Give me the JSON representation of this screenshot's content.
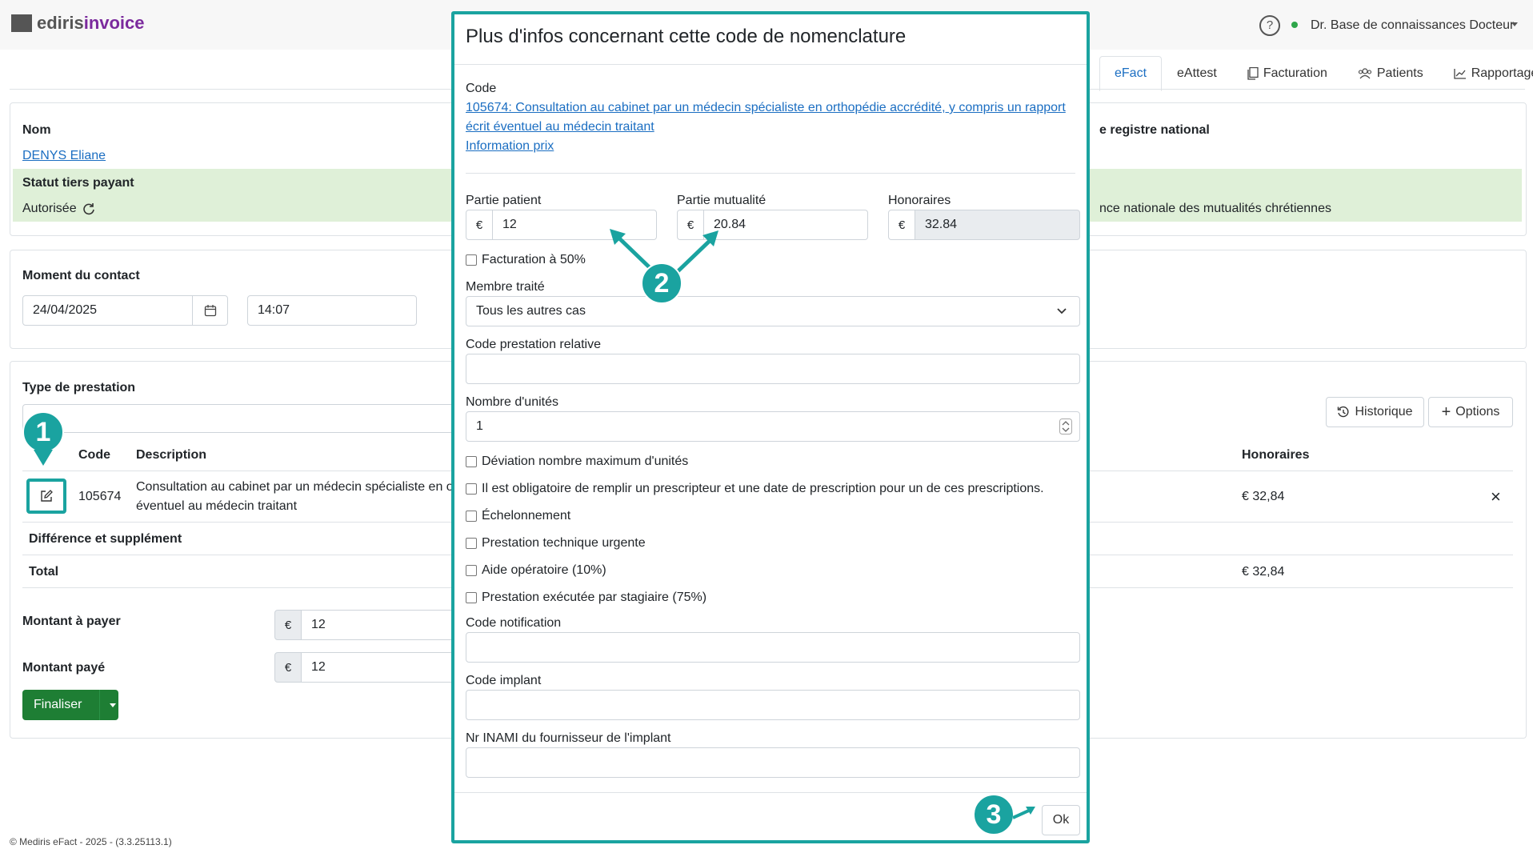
{
  "app": {
    "logo_part1": "ediris",
    "logo_part2": "invoice",
    "user_name": "Dr. Base de connaissances Docteur",
    "help_symbol": "?"
  },
  "tabs": [
    {
      "label": "eFact",
      "icon": ""
    },
    {
      "label": "eAttest",
      "icon": ""
    },
    {
      "label": "Facturation",
      "icon": "copy-icon"
    },
    {
      "label": "Patients",
      "icon": "people-icon"
    },
    {
      "label": "Rapportage",
      "icon": "chart-icon"
    }
  ],
  "patient": {
    "name_label": "Nom",
    "name_value": "DENYS Eliane",
    "national_register_label": "e registre national",
    "tiers_label": "Statut tiers payant",
    "tiers_value": "Autorisée",
    "mutuality_value": "nce nationale des mutualités chrétiennes"
  },
  "contact": {
    "label": "Moment du contact",
    "date": "24/04/2025",
    "time": "14:07"
  },
  "prestation": {
    "label": "Type de prestation",
    "history_button": "Historique",
    "options_button": "Options",
    "col_code": "Code",
    "col_description": "Description",
    "col_honoraires": "Honoraires",
    "row_code": "105674",
    "row_description_1": "Consultation au cabinet par un médecin spécialiste en o",
    "row_description_2": "éventuel au médecin traitant",
    "row_honoraires": "€ 32,84",
    "remove_symbol": "×",
    "diff_label": "Différence et supplément",
    "total_label": "Total",
    "total_value": "€ 32,84"
  },
  "payment": {
    "amount_due_label": "Montant à payer",
    "amount_due_value": "12",
    "amount_paid_label": "Montant payé",
    "amount_paid_value": "12",
    "currency": "€",
    "finalize_button": "Finaliser"
  },
  "footer": "© Mediris eFact - 2025 - (3.3.25113.1)",
  "modal": {
    "title": "Plus d'infos concernant cette code de nomenclature",
    "code_label": "Code",
    "code_link_1": "105674: Consultation au cabinet par un médecin spécialiste en orthopédie accrédité, y compris un rapport",
    "code_link_2": "écrit éventuel au médecin traitant",
    "price_info_link": "Information prix",
    "partie_patient_label": "Partie patient",
    "partie_patient_value": "12",
    "partie_mutualite_label": "Partie mutualité",
    "partie_mutualite_value": "20.84",
    "honoraires_label": "Honoraires",
    "honoraires_value": "32.84",
    "currency": "€",
    "facturation50": "Facturation à 50%",
    "membre_label": "Membre traité",
    "membre_value": "Tous les autres cas",
    "code_relative_label": "Code prestation relative",
    "units_label": "Nombre d'unités",
    "units_value": "1",
    "checks": [
      "Déviation nombre maximum d'unités",
      "Il est obligatoire de remplir un prescripteur et une date de prescription pour un de ces prescriptions.",
      "Échelonnement",
      "Prestation technique urgente",
      "Aide opératoire (10%)",
      "Prestation exécutée par stagiaire (75%)"
    ],
    "notification_label": "Code notification",
    "implant_label": "Code implant",
    "inami_label": "Nr INAMI du fournisseur de l'implant",
    "ok_button": "Ok"
  },
  "markers": [
    "1",
    "2",
    "3"
  ],
  "colors": {
    "accent_teal": "#1aa3a0",
    "success_green": "#1e7e34",
    "link_blue": "#1b6ec2",
    "band_green": "#dff0d8",
    "brand_purple": "#7b2a9d"
  }
}
